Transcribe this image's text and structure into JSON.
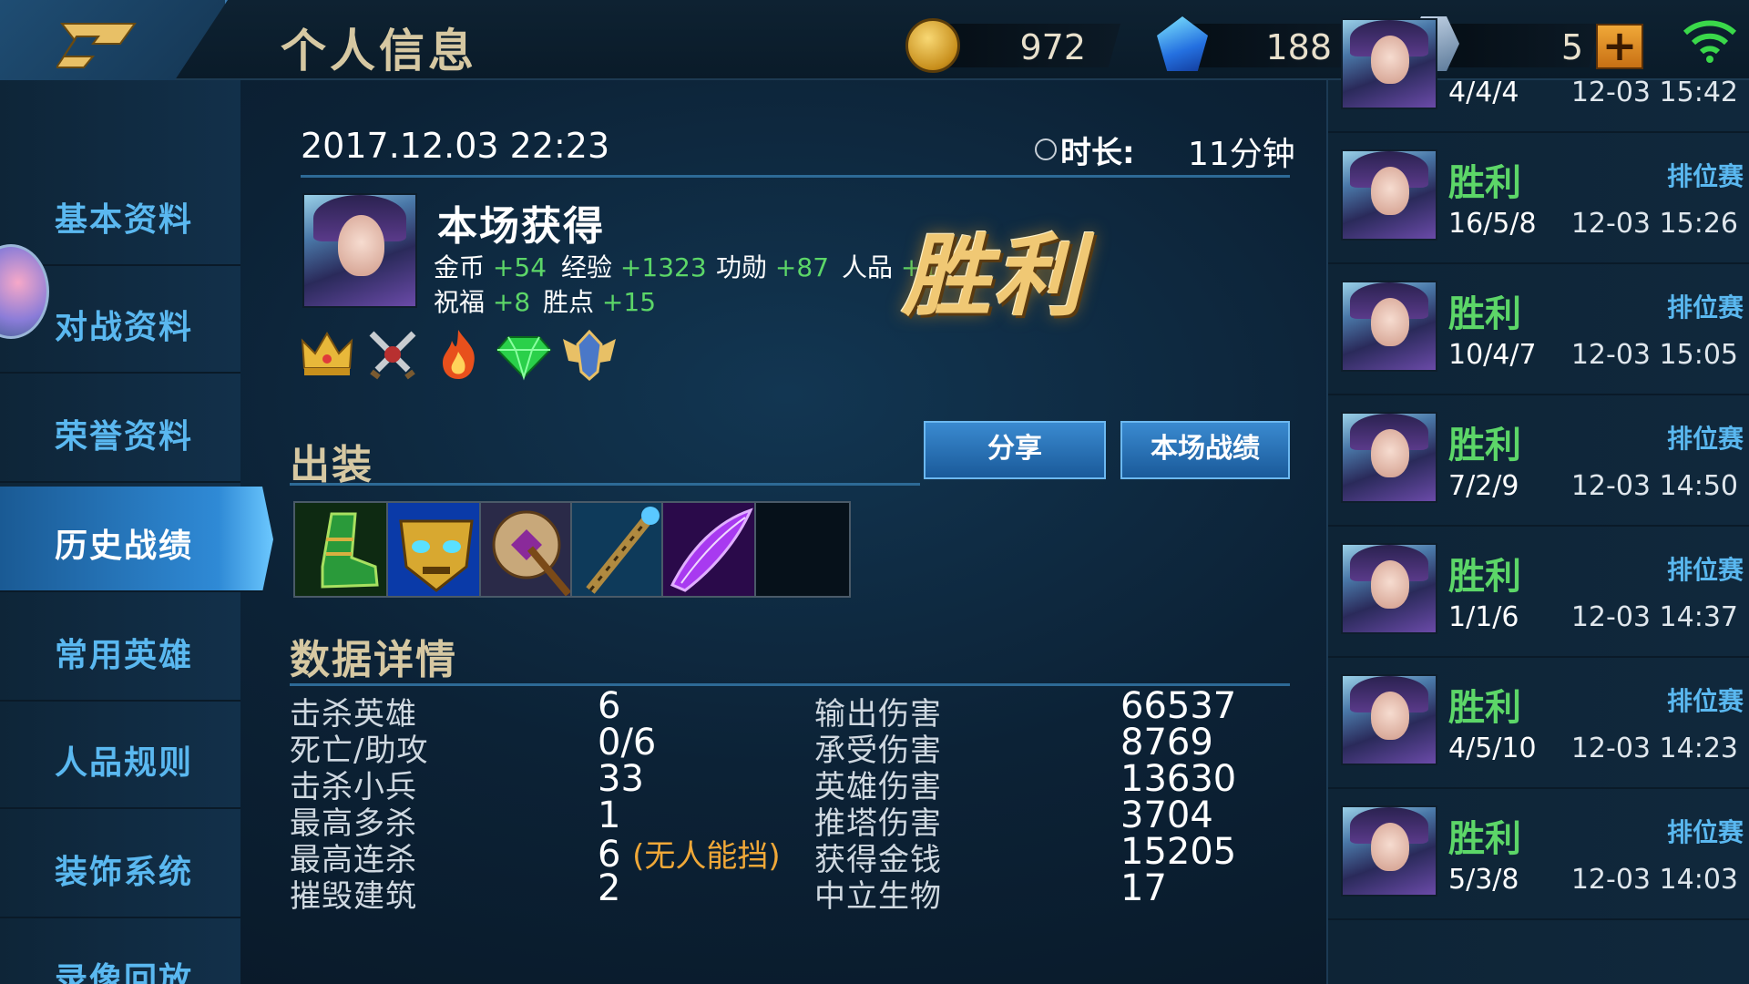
{
  "header": {
    "title": "个人信息",
    "gold": "972",
    "diamond": "188",
    "voucher": "5"
  },
  "sidebar": {
    "items": [
      {
        "label": "基本资料"
      },
      {
        "label": "对战资料"
      },
      {
        "label": "荣誉资料"
      },
      {
        "label": "历史战绩",
        "active": true
      },
      {
        "label": "常用英雄"
      },
      {
        "label": "人品规则"
      },
      {
        "label": "装饰系统"
      },
      {
        "label": "录像回放"
      }
    ]
  },
  "match": {
    "datetime": "2017.12.03 22:23",
    "duration_label": "时长:",
    "duration": "11分钟",
    "gains_title": "本场获得",
    "gains": [
      {
        "label": "金币",
        "value": "+54"
      },
      {
        "label": "经验",
        "value": "+1323"
      },
      {
        "label": "功勋",
        "value": "+87"
      },
      {
        "label": "人品",
        "value": "+1"
      },
      {
        "label": "祝福",
        "value": "+8"
      },
      {
        "label": "胜点",
        "value": "+15"
      }
    ],
    "result": "胜利",
    "honor_icons": [
      "crown-icon",
      "crossed-swords-icon",
      "fire-icon",
      "emerald-icon",
      "winged-emblem-icon"
    ]
  },
  "build": {
    "title": "出装",
    "share_label": "分享",
    "stats_label": "本场战绩",
    "items": [
      "boots-icon",
      "golden-mask-icon",
      "axe-icon",
      "staff-icon",
      "purple-blade-icon",
      "empty-slot"
    ]
  },
  "details": {
    "title": "数据详情",
    "left": [
      {
        "label": "击杀英雄",
        "value": "6"
      },
      {
        "label": "死亡/助攻",
        "value": "0/6"
      },
      {
        "label": "击杀小兵",
        "value": "33"
      },
      {
        "label": "最高多杀",
        "value": "1"
      },
      {
        "label": "最高连杀",
        "value": "6",
        "tag": "(无人能挡)"
      },
      {
        "label": "摧毁建筑",
        "value": "2"
      }
    ],
    "right": [
      {
        "label": "输出伤害",
        "value": "66537"
      },
      {
        "label": "承受伤害",
        "value": "8769"
      },
      {
        "label": "英雄伤害",
        "value": "13630"
      },
      {
        "label": "推塔伤害",
        "value": "3704"
      },
      {
        "label": "获得金钱",
        "value": "15205"
      },
      {
        "label": "中立生物",
        "value": "17"
      }
    ]
  },
  "history": [
    {
      "result": "",
      "mode": "",
      "kda": "4/4/4",
      "time": "12-03 15:42"
    },
    {
      "result": "胜利",
      "mode": "排位赛",
      "kda": "16/5/8",
      "time": "12-03 15:26"
    },
    {
      "result": "胜利",
      "mode": "排位赛",
      "kda": "10/4/7",
      "time": "12-03 15:05"
    },
    {
      "result": "胜利",
      "mode": "排位赛",
      "kda": "7/2/9",
      "time": "12-03 14:50"
    },
    {
      "result": "胜利",
      "mode": "排位赛",
      "kda": "1/1/6",
      "time": "12-03 14:37"
    },
    {
      "result": "胜利",
      "mode": "排位赛",
      "kda": "4/5/10",
      "time": "12-03 14:23"
    },
    {
      "result": "胜利",
      "mode": "排位赛",
      "kda": "5/3/8",
      "time": "12-03 14:03"
    }
  ]
}
